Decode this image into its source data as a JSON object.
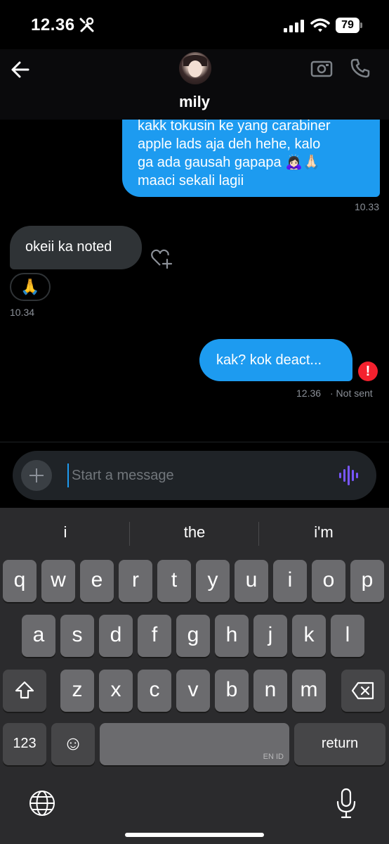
{
  "status_bar": {
    "time": "12.36",
    "battery": "79"
  },
  "header": {
    "contact_name": "mily"
  },
  "messages": [
    {
      "direction": "outgoing",
      "text_lines": [
        "kakk tokusin ke yang carabiner",
        "apple lads aja deh hehe, kalo",
        "ga ada gausah gapapa 🙇🏻‍♀️🙏🏻",
        "maaci sekali lagii"
      ],
      "time": "10.33"
    },
    {
      "direction": "incoming",
      "text": "okeii ka noted",
      "reaction": "🙏",
      "time": "10.34"
    },
    {
      "direction": "outgoing",
      "text": "kak? kok deact...",
      "time": "12.36",
      "status": "· Not sent",
      "error_glyph": "!"
    }
  ],
  "composer": {
    "placeholder": "Start a message",
    "value": ""
  },
  "keyboard": {
    "suggestions": [
      "i",
      "the",
      "i'm"
    ],
    "row1": [
      "q",
      "w",
      "e",
      "r",
      "t",
      "y",
      "u",
      "i",
      "o",
      "p"
    ],
    "row2": [
      "a",
      "s",
      "d",
      "f",
      "g",
      "h",
      "j",
      "k",
      "l"
    ],
    "row3": [
      "z",
      "x",
      "c",
      "v",
      "b",
      "n",
      "m"
    ],
    "numbers_key": "123",
    "emoji_key": "☺",
    "space_lang": "EN ID",
    "return_key": "return"
  },
  "colors": {
    "accent": "#1d9bf0",
    "incoming_bubble": "#2f3336",
    "error": "#f4212e",
    "voice": "#7856ff"
  }
}
